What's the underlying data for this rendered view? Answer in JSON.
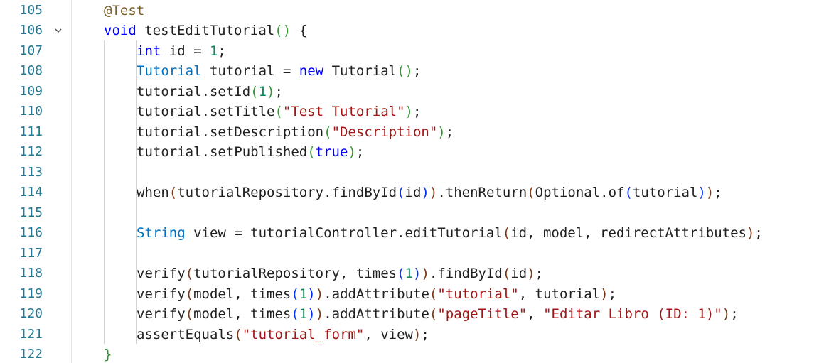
{
  "editor": {
    "line_numbers": [
      "105",
      "106",
      "107",
      "108",
      "109",
      "110",
      "111",
      "112",
      "113",
      "114",
      "115",
      "116",
      "117",
      "118",
      "119",
      "120",
      "121",
      "122"
    ],
    "fold_icon": "chevron-down-icon",
    "colors": {
      "line_number": "#237893",
      "keyword": "#0000ff",
      "type": "#0070c1",
      "string": "#a31515",
      "number": "#098658",
      "text": "#1f1f1f"
    },
    "lines": [
      [
        {
          "t": "@Test",
          "c": "ann"
        }
      ],
      [
        {
          "t": "void",
          "c": "kw"
        },
        {
          "t": " testEditTutorial",
          "c": "txt"
        },
        {
          "t": "(",
          "c": "p2"
        },
        {
          "t": ")",
          "c": "p2"
        },
        {
          "t": " {",
          "c": "txt"
        }
      ],
      [
        {
          "t": "int",
          "c": "kw"
        },
        {
          "t": " id = ",
          "c": "txt"
        },
        {
          "t": "1",
          "c": "num"
        },
        {
          "t": ";",
          "c": "txt"
        }
      ],
      [
        {
          "t": "Tutorial",
          "c": "ty"
        },
        {
          "t": " tutorial = ",
          "c": "txt"
        },
        {
          "t": "new",
          "c": "kw"
        },
        {
          "t": " Tutorial",
          "c": "txt"
        },
        {
          "t": "(",
          "c": "p2"
        },
        {
          "t": ")",
          "c": "p2"
        },
        {
          "t": ";",
          "c": "txt"
        }
      ],
      [
        {
          "t": "tutorial.setId",
          "c": "txt"
        },
        {
          "t": "(",
          "c": "p2"
        },
        {
          "t": "1",
          "c": "num"
        },
        {
          "t": ")",
          "c": "p2"
        },
        {
          "t": ";",
          "c": "txt"
        }
      ],
      [
        {
          "t": "tutorial.setTitle",
          "c": "txt"
        },
        {
          "t": "(",
          "c": "p2"
        },
        {
          "t": "\"Test Tutorial\"",
          "c": "str"
        },
        {
          "t": ")",
          "c": "p2"
        },
        {
          "t": ";",
          "c": "txt"
        }
      ],
      [
        {
          "t": "tutorial.setDescription",
          "c": "txt"
        },
        {
          "t": "(",
          "c": "p2"
        },
        {
          "t": "\"Description\"",
          "c": "str"
        },
        {
          "t": ")",
          "c": "p2"
        },
        {
          "t": ";",
          "c": "txt"
        }
      ],
      [
        {
          "t": "tutorial.setPublished",
          "c": "txt"
        },
        {
          "t": "(",
          "c": "p2"
        },
        {
          "t": "true",
          "c": "kw"
        },
        {
          "t": ")",
          "c": "p2"
        },
        {
          "t": ";",
          "c": "txt"
        }
      ],
      [],
      [
        {
          "t": "when",
          "c": "txt"
        },
        {
          "t": "(",
          "c": "p3"
        },
        {
          "t": "tutorialRepository.findById",
          "c": "txt"
        },
        {
          "t": "(",
          "c": "p1"
        },
        {
          "t": "id",
          "c": "txt"
        },
        {
          "t": ")",
          "c": "p1"
        },
        {
          "t": ")",
          "c": "p3"
        },
        {
          "t": ".thenReturn",
          "c": "txt"
        },
        {
          "t": "(",
          "c": "p3"
        },
        {
          "t": "Optional.of",
          "c": "txt"
        },
        {
          "t": "(",
          "c": "p1"
        },
        {
          "t": "tutorial",
          "c": "txt"
        },
        {
          "t": ")",
          "c": "p1"
        },
        {
          "t": ")",
          "c": "p3"
        },
        {
          "t": ";",
          "c": "txt"
        }
      ],
      [],
      [
        {
          "t": "String",
          "c": "ty"
        },
        {
          "t": " view = tutorialController.editTutorial",
          "c": "txt"
        },
        {
          "t": "(",
          "c": "p3"
        },
        {
          "t": "id, model, redirectAttributes",
          "c": "txt"
        },
        {
          "t": ")",
          "c": "p3"
        },
        {
          "t": ";",
          "c": "txt"
        }
      ],
      [],
      [
        {
          "t": "verify",
          "c": "txt"
        },
        {
          "t": "(",
          "c": "p3"
        },
        {
          "t": "tutorialRepository, times",
          "c": "txt"
        },
        {
          "t": "(",
          "c": "p1"
        },
        {
          "t": "1",
          "c": "num"
        },
        {
          "t": ")",
          "c": "p1"
        },
        {
          "t": ")",
          "c": "p3"
        },
        {
          "t": ".findById",
          "c": "txt"
        },
        {
          "t": "(",
          "c": "p3"
        },
        {
          "t": "id",
          "c": "txt"
        },
        {
          "t": ")",
          "c": "p3"
        },
        {
          "t": ";",
          "c": "txt"
        }
      ],
      [
        {
          "t": "verify",
          "c": "txt"
        },
        {
          "t": "(",
          "c": "p3"
        },
        {
          "t": "model, times",
          "c": "txt"
        },
        {
          "t": "(",
          "c": "p1"
        },
        {
          "t": "1",
          "c": "num"
        },
        {
          "t": ")",
          "c": "p1"
        },
        {
          "t": ")",
          "c": "p3"
        },
        {
          "t": ".addAttribute",
          "c": "txt"
        },
        {
          "t": "(",
          "c": "p3"
        },
        {
          "t": "\"tutorial\"",
          "c": "str"
        },
        {
          "t": ", tutorial",
          "c": "txt"
        },
        {
          "t": ")",
          "c": "p3"
        },
        {
          "t": ";",
          "c": "txt"
        }
      ],
      [
        {
          "t": "verify",
          "c": "txt"
        },
        {
          "t": "(",
          "c": "p3"
        },
        {
          "t": "model, times",
          "c": "txt"
        },
        {
          "t": "(",
          "c": "p1"
        },
        {
          "t": "1",
          "c": "num"
        },
        {
          "t": ")",
          "c": "p1"
        },
        {
          "t": ")",
          "c": "p3"
        },
        {
          "t": ".addAttribute",
          "c": "txt"
        },
        {
          "t": "(",
          "c": "p3"
        },
        {
          "t": "\"pageTitle\"",
          "c": "str"
        },
        {
          "t": ", ",
          "c": "txt"
        },
        {
          "t": "\"Editar Libro (ID: 1)\"",
          "c": "str"
        },
        {
          "t": ")",
          "c": "p3"
        },
        {
          "t": ";",
          "c": "txt"
        }
      ],
      [
        {
          "t": "assertEquals",
          "c": "txt"
        },
        {
          "t": "(",
          "c": "p3"
        },
        {
          "t": "\"tutorial_form\"",
          "c": "str"
        },
        {
          "t": ", view",
          "c": "txt"
        },
        {
          "t": ")",
          "c": "p3"
        },
        {
          "t": ";",
          "c": "txt"
        }
      ],
      [
        {
          "t": "}",
          "c": "p2"
        }
      ]
    ],
    "indent": [
      0,
      0,
      1,
      1,
      1,
      1,
      1,
      1,
      0,
      1,
      0,
      1,
      0,
      1,
      1,
      1,
      1,
      0
    ]
  }
}
